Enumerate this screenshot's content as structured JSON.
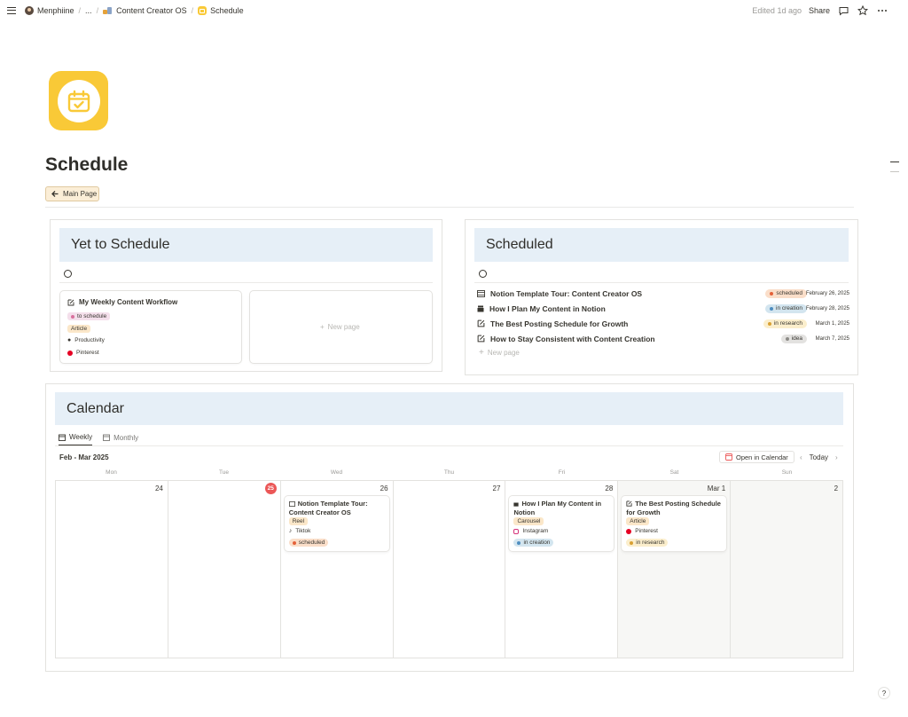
{
  "topbar": {
    "breadcrumbs": [
      "Menphiine",
      "...",
      "Content Creator OS",
      "Schedule"
    ],
    "edited": "Edited 1d ago",
    "share": "Share"
  },
  "page": {
    "title": "Schedule",
    "main_page_button": "Main Page"
  },
  "yet_to_schedule": {
    "title": "Yet to Schedule",
    "card": {
      "title": "My Weekly Content Workflow",
      "status": "to schedule",
      "type": "Article",
      "category": "Productivity",
      "platform": "Pinterest"
    },
    "new_page": "New page"
  },
  "scheduled": {
    "title": "Scheduled",
    "rows": [
      {
        "title": "Notion Template Tour: Content Creator OS",
        "status": "scheduled",
        "date": "February 26, 2025"
      },
      {
        "title": "How I Plan My Content in Notion",
        "status": "in creation",
        "date": "February 28, 2025"
      },
      {
        "title": "The Best Posting Schedule for Growth",
        "status": "in research",
        "date": "March 1, 2025"
      },
      {
        "title": "How to Stay Consistent with Content Creation",
        "status": "idea",
        "date": "March 7, 2025"
      }
    ],
    "new_page": "New page"
  },
  "calendar": {
    "title": "Calendar",
    "tabs": [
      "Weekly",
      "Monthly"
    ],
    "range": "Feb - Mar 2025",
    "open_in_calendar": "Open in Calendar",
    "today": "Today",
    "weekdays": [
      "Mon",
      "Tue",
      "Wed",
      "Thu",
      "Fri",
      "Sat",
      "Sun"
    ],
    "days": [
      "24",
      "25",
      "26",
      "27",
      "28",
      "Mar 1",
      "2"
    ],
    "events": [
      {
        "title": "Notion Template Tour: Content Creator OS",
        "type": "Reel",
        "platform": "Tiktok",
        "status": "scheduled"
      },
      {
        "title": "How I Plan My Content in Notion",
        "type": "Carousel",
        "platform": "Instagram",
        "status": "in creation"
      },
      {
        "title": "The Best Posting Schedule for Growth",
        "type": "Article",
        "platform": "Pinterest",
        "status": "in research"
      }
    ]
  },
  "colors": {
    "accent_yellow": "#f9c937",
    "header_blue": "#e6eff7",
    "today_red": "#eb5757",
    "status_scheduled_bg": "#fadec9",
    "status_creation_bg": "#d3e5ef",
    "status_research_bg": "#fbeecc",
    "status_idea_bg": "#e3e2e0",
    "status_toschedule_bg": "#f4dfeb"
  }
}
